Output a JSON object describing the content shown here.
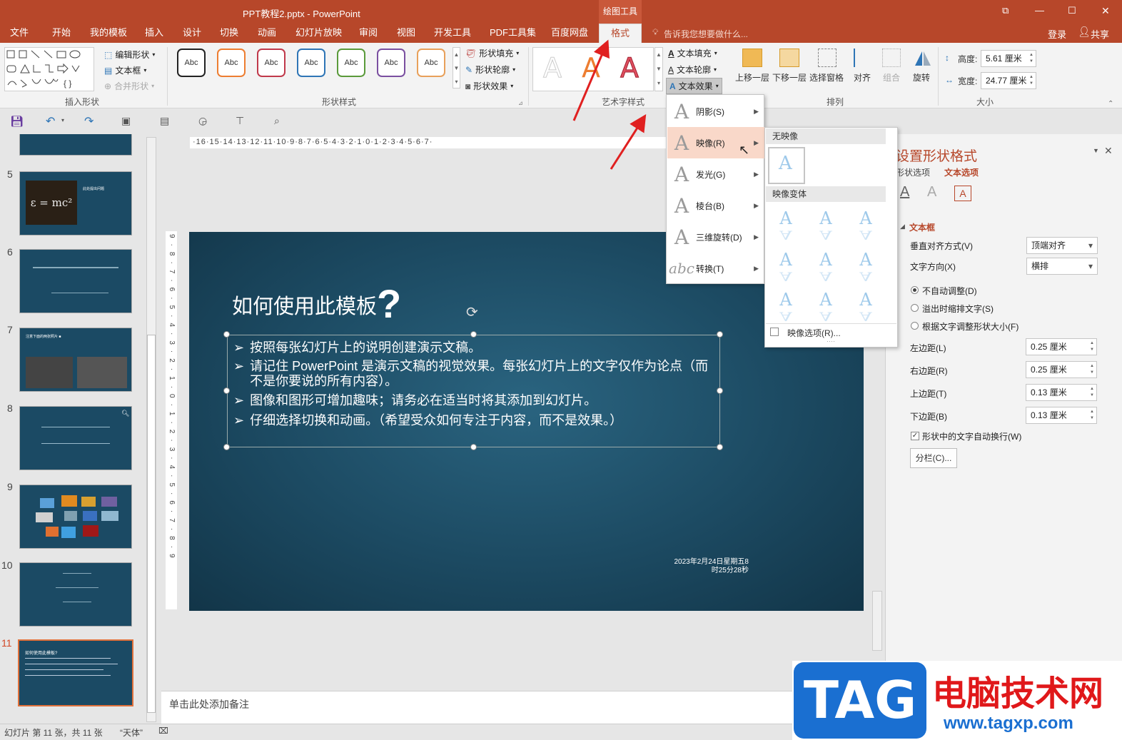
{
  "window": {
    "title": "PPT教程2.pptx - PowerPoint",
    "context_tool": "绘图工具",
    "controls": {
      "restore": "⧉",
      "minimize": "—",
      "maximize": "☐",
      "close": "✕"
    }
  },
  "tabs": [
    "文件",
    "开始",
    "我的模板",
    "插入",
    "设计",
    "切换",
    "动画",
    "幻灯片放映",
    "审阅",
    "视图",
    "开发工具",
    "PDF工具集",
    "百度网盘",
    "格式"
  ],
  "tell_me": "告诉我您想要做什么...",
  "account": {
    "login": "登录",
    "share": "共享"
  },
  "ribbon": {
    "insert_shapes": {
      "label": "插入形状",
      "edit_shape": "编辑形状",
      "text_box": "文本框",
      "merge_shapes": "合并形状"
    },
    "shape_styles": {
      "label": "形状样式",
      "abc": "Abc",
      "swatches": [
        "#222222",
        "#ed7d31",
        "#c0394a",
        "#2e75b6",
        "#5a9a3a",
        "#7a4fa0",
        "#e8a05a"
      ],
      "fill": "形状填充",
      "outline": "形状轮廓",
      "effects": "形状效果"
    },
    "wordart": {
      "label": "艺术字样式",
      "text_fill": "文本填充",
      "text_outline": "文本轮廓",
      "text_effects": "文本效果",
      "glyph": "A"
    },
    "arrange": {
      "label": "排列",
      "bring_forward": "上移一层",
      "send_backward": "下移一层",
      "selection_pane": "选择窗格",
      "align": "对齐",
      "group": "组合",
      "rotate": "旋转"
    },
    "size": {
      "label": "大小",
      "height_label": "高度:",
      "height": "5.61 厘米",
      "width_label": "宽度:",
      "width": "24.77 厘米"
    }
  },
  "text_effects_menu": [
    {
      "label": "阴影(S)",
      "glyph": "A"
    },
    {
      "label": "映像(R)",
      "glyph": "A"
    },
    {
      "label": "发光(G)",
      "glyph": "A"
    },
    {
      "label": "棱台(B)",
      "glyph": "A"
    },
    {
      "label": "三维旋转(D)",
      "glyph": "A"
    },
    {
      "label": "转换(T)",
      "glyph": "abc"
    }
  ],
  "reflection_submenu": {
    "no_reflection": "无映像",
    "variants": "映像变体",
    "options": "映像选项(R)...",
    "glyph": "A"
  },
  "ruler": {
    "horizontal": "·16·15·14·13·12·11·10·9·8·7·6·5·4·3·2·1·0·1·2·3·4·5·6·7·",
    "vertical": "9·8·7·6·5·4·3·2·1·0·1·2·3·4·5·6·7·8·9"
  },
  "thumbnails": [
    {
      "num": "5",
      "title": "此处提出问题"
    },
    {
      "num": "6",
      "title": ""
    },
    {
      "num": "7",
      "title": "注意下面的两张照片 ■"
    },
    {
      "num": "8",
      "title": ""
    },
    {
      "num": "9",
      "title": ""
    },
    {
      "num": "10",
      "title": ""
    },
    {
      "num": "11",
      "title": "如何使用此模板?"
    }
  ],
  "thumb_formula": "ε = mc²",
  "slide": {
    "title": "如何使用此模板",
    "title_mark": "?",
    "bullets": [
      "按照每张幻灯片上的说明创建演示文稿。",
      "请记住 PowerPoint 是演示文稿的视觉效果。每张幻灯片上的文字仅作为论点（而不是你要说的所有内容）。",
      "图像和图形可增加趣味；请务必在适当时将其添加到幻灯片。",
      "仔细选择切换和动画。（希望受众如何专注于内容，而不是效果。）"
    ],
    "bullet_mark": "➢",
    "date_line1": "2023年2月24日星期五8",
    "date_line2": "时25分28秒"
  },
  "notes_placeholder": "单击此处添加备注",
  "format_pane": {
    "title": "设置形状格式",
    "tab_shape": "形状选项",
    "tab_text": "文本选项",
    "section": "文本框",
    "valign_label": "垂直对齐方式(V)",
    "valign": "顶端对齐",
    "direction_label": "文字方向(X)",
    "direction": "横排",
    "autofit_none": "不自动调整(D)",
    "autofit_shrink": "溢出时缩排文字(S)",
    "autofit_resize": "根据文字调整形状大小(F)",
    "margin_left_label": "左边距(L)",
    "margin_left": "0.25 厘米",
    "margin_right_label": "右边距(R)",
    "margin_right": "0.25 厘米",
    "margin_top_label": "上边距(T)",
    "margin_top": "0.13 厘米",
    "margin_bottom_label": "下边距(B)",
    "margin_bottom": "0.13 厘米",
    "wrap_label": "形状中的文字自动换行(W)",
    "columns_button": "分栏(C)..."
  },
  "status": {
    "slide_info": "幻灯片 第 11 张，共 11 张",
    "theme": "“天体”"
  },
  "watermark": {
    "tag": "TAG",
    "site_name": "电脑技术网",
    "url": "www.tagxp.com"
  },
  "colors": {
    "accent": "#b7472a",
    "slide_bg": "#1c4a62",
    "annotation_arrow": "#e02020"
  }
}
